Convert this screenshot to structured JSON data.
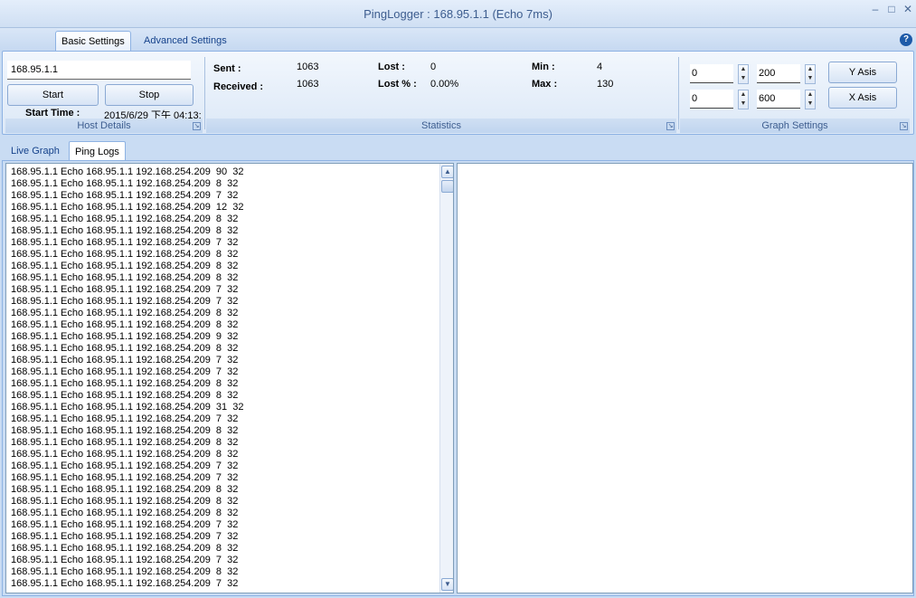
{
  "window": {
    "title": "PingLogger : 168.95.1.1 (Echo 7ms)",
    "minimize": "–",
    "maximize": "□",
    "close": "✕"
  },
  "ribbon": {
    "tabs": [
      "Basic Settings",
      "Advanced Settings"
    ],
    "help_icon": "?"
  },
  "host": {
    "value": "168.95.1.1",
    "start_label": "Start",
    "stop_label": "Stop",
    "start_time_label": "Start Time :",
    "start_time_value": "2015/6/29 下午 04:13:",
    "group_label": "Host Details"
  },
  "stats": {
    "sent_label": "Sent :",
    "sent_value": "1063",
    "received_label": "Received :",
    "received_value": "1063",
    "lost_label": "Lost :",
    "lost_value": "0",
    "lost_pct_label": "Lost  % :",
    "lost_pct_value": "0.00%",
    "min_label": "Min :",
    "min_value": "4",
    "max_label": "Max :",
    "max_value": "130",
    "group_label": "Statistics"
  },
  "graph": {
    "y_min": "0",
    "y_max": "200",
    "x_min": "0",
    "x_max": "600",
    "y_button": "Y Asis",
    "x_button": "X Asis",
    "group_label": "Graph Settings"
  },
  "content_tabs": [
    "Live Graph",
    "Ping Logs"
  ],
  "logs": [
    "168.95.1.1 Echo 168.95.1.1 192.168.254.209  90  32",
    "168.95.1.1 Echo 168.95.1.1 192.168.254.209  8  32",
    "168.95.1.1 Echo 168.95.1.1 192.168.254.209  7  32",
    "168.95.1.1 Echo 168.95.1.1 192.168.254.209  12  32",
    "168.95.1.1 Echo 168.95.1.1 192.168.254.209  8  32",
    "168.95.1.1 Echo 168.95.1.1 192.168.254.209  8  32",
    "168.95.1.1 Echo 168.95.1.1 192.168.254.209  7  32",
    "168.95.1.1 Echo 168.95.1.1 192.168.254.209  8  32",
    "168.95.1.1 Echo 168.95.1.1 192.168.254.209  8  32",
    "168.95.1.1 Echo 168.95.1.1 192.168.254.209  8  32",
    "168.95.1.1 Echo 168.95.1.1 192.168.254.209  7  32",
    "168.95.1.1 Echo 168.95.1.1 192.168.254.209  7  32",
    "168.95.1.1 Echo 168.95.1.1 192.168.254.209  8  32",
    "168.95.1.1 Echo 168.95.1.1 192.168.254.209  8  32",
    "168.95.1.1 Echo 168.95.1.1 192.168.254.209  9  32",
    "168.95.1.1 Echo 168.95.1.1 192.168.254.209  8  32",
    "168.95.1.1 Echo 168.95.1.1 192.168.254.209  7  32",
    "168.95.1.1 Echo 168.95.1.1 192.168.254.209  7  32",
    "168.95.1.1 Echo 168.95.1.1 192.168.254.209  8  32",
    "168.95.1.1 Echo 168.95.1.1 192.168.254.209  8  32",
    "168.95.1.1 Echo 168.95.1.1 192.168.254.209  31  32",
    "168.95.1.1 Echo 168.95.1.1 192.168.254.209  7  32",
    "168.95.1.1 Echo 168.95.1.1 192.168.254.209  8  32",
    "168.95.1.1 Echo 168.95.1.1 192.168.254.209  8  32",
    "168.95.1.1 Echo 168.95.1.1 192.168.254.209  8  32",
    "168.95.1.1 Echo 168.95.1.1 192.168.254.209  7  32",
    "168.95.1.1 Echo 168.95.1.1 192.168.254.209  7  32",
    "168.95.1.1 Echo 168.95.1.1 192.168.254.209  8  32",
    "168.95.1.1 Echo 168.95.1.1 192.168.254.209  8  32",
    "168.95.1.1 Echo 168.95.1.1 192.168.254.209  8  32",
    "168.95.1.1 Echo 168.95.1.1 192.168.254.209  7  32",
    "168.95.1.1 Echo 168.95.1.1 192.168.254.209  7  32",
    "168.95.1.1 Echo 168.95.1.1 192.168.254.209  8  32",
    "168.95.1.1 Echo 168.95.1.1 192.168.254.209  7  32",
    "168.95.1.1 Echo 168.95.1.1 192.168.254.209  8  32",
    "168.95.1.1 Echo 168.95.1.1 192.168.254.209  7  32"
  ]
}
